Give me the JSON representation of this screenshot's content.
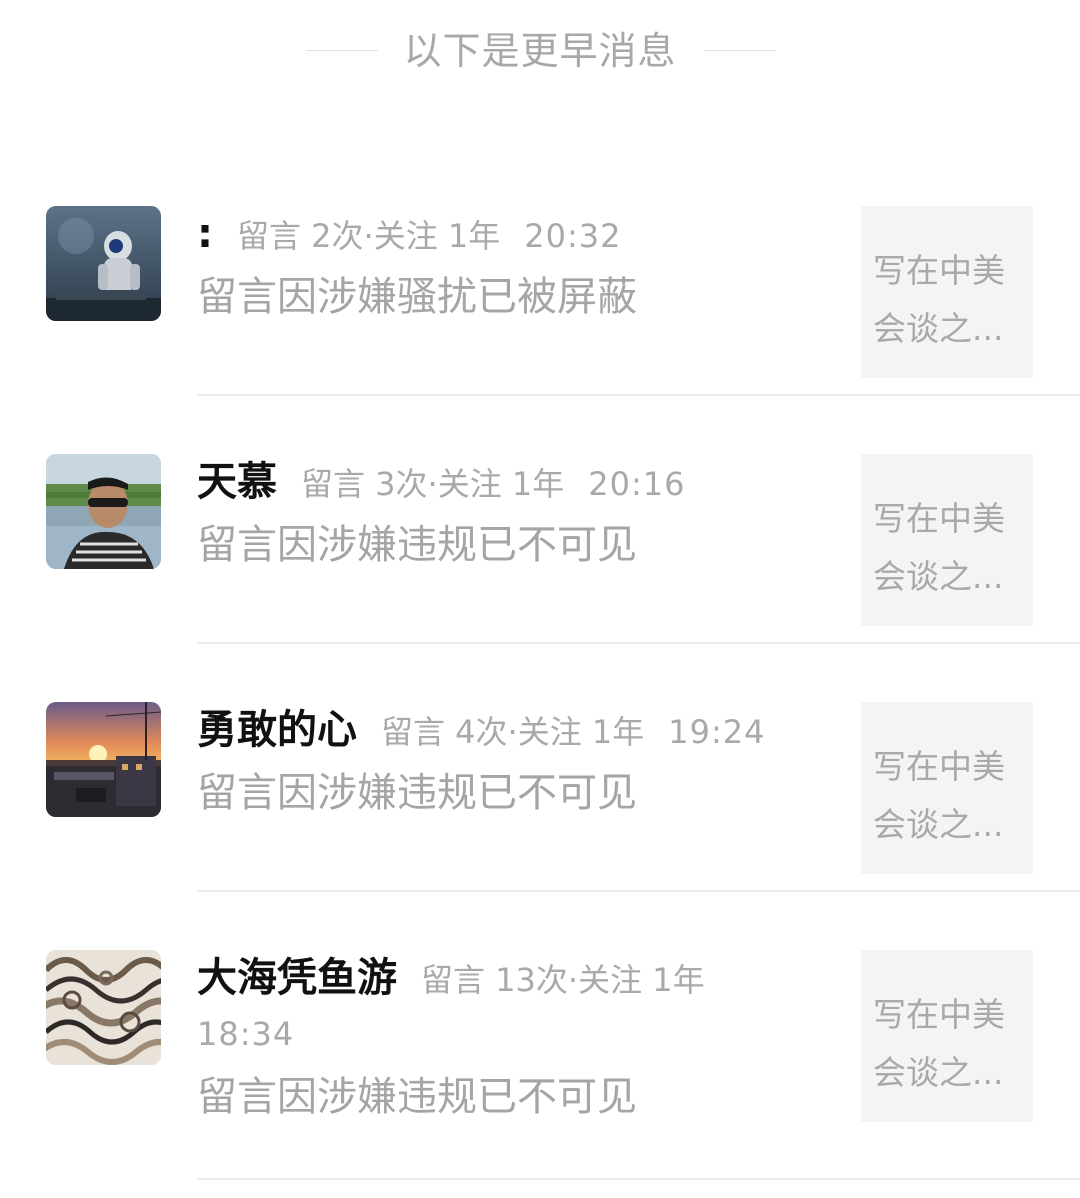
{
  "header": {
    "label": "以下是更早消息"
  },
  "messages": [
    {
      "name": ":",
      "comment_count": "留言 2次",
      "follow": "关注 1年",
      "time": "20:32",
      "body": "留言因涉嫌骚扰已被屏蔽",
      "article_line1": "写在中美",
      "article_line2": "会谈之...",
      "avatar": "astronaut-avatar"
    },
    {
      "name": "天慕",
      "comment_count": "留言 3次",
      "follow": "关注 1年",
      "time": "20:16",
      "body": "留言因涉嫌违规已不可见",
      "article_line1": "写在中美",
      "article_line2": "会谈之...",
      "avatar": "man-sunglasses-avatar"
    },
    {
      "name": "勇敢的心",
      "comment_count": "留言 4次",
      "follow": "关注 1年",
      "time": "19:24",
      "body": "留言因涉嫌违规已不可见",
      "article_line1": "写在中美",
      "article_line2": "会谈之...",
      "avatar": "sunset-avatar"
    },
    {
      "name": "大海凭鱼游",
      "comment_count": "留言 13次",
      "follow": "关注 1年",
      "time": "18:34",
      "body": "留言因涉嫌违规已不可见",
      "article_line1": "写在中美",
      "article_line2": "会谈之...",
      "avatar": "pattern-avatar"
    }
  ],
  "colors": {
    "name": "#111111",
    "meta": "#a9a9a9",
    "body": "#a5a5a5",
    "article_bg": "#f4f4f4",
    "divider": "#ececec"
  }
}
